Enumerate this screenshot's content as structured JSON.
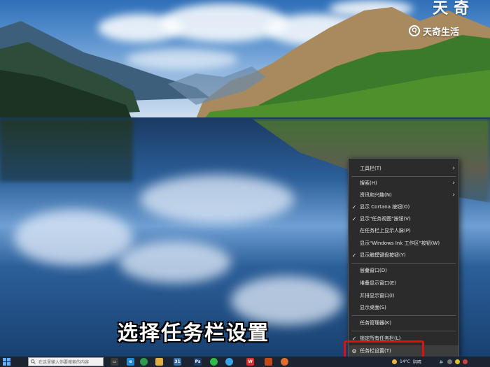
{
  "watermark": {
    "brand": "天奇生活",
    "logo_glyph": "Q",
    "corner_text": "天奇"
  },
  "subtitle": "选择任务栏设置",
  "context_menu": {
    "items": [
      {
        "label": "工具栏(T)",
        "has_submenu": true,
        "checked": false
      },
      {
        "label": "搜索(H)",
        "has_submenu": true,
        "checked": false
      },
      {
        "label": "资讯和兴趣(N)",
        "has_submenu": true,
        "checked": false
      },
      {
        "label": "显示 Cortana 按钮(O)",
        "has_submenu": false,
        "checked": true
      },
      {
        "label": "显示\"任务视图\"按钮(V)",
        "has_submenu": false,
        "checked": true
      },
      {
        "label": "在任务栏上显示人脉(P)",
        "has_submenu": false,
        "checked": false
      },
      {
        "label": "显示\"Windows Ink 工作区\"按钮(W)",
        "has_submenu": false,
        "checked": false
      },
      {
        "label": "显示触摸键盘按钮(Y)",
        "has_submenu": false,
        "checked": true
      },
      {
        "label": "层叠窗口(D)",
        "has_submenu": false,
        "checked": false
      },
      {
        "label": "堆叠显示窗口(E)",
        "has_submenu": false,
        "checked": false
      },
      {
        "label": "并排显示窗口(I)",
        "has_submenu": false,
        "checked": false
      },
      {
        "label": "显示桌面(S)",
        "has_submenu": false,
        "checked": false
      },
      {
        "label": "任务管理器(K)",
        "has_submenu": false,
        "checked": false
      },
      {
        "label": "锁定所有任务栏(L)",
        "has_submenu": false,
        "checked": true
      },
      {
        "label": "任务栏设置(T)",
        "has_submenu": false,
        "checked": false,
        "icon": "gear-icon",
        "highlighted": true
      }
    ]
  },
  "taskbar": {
    "search_placeholder": "在这里输入你要搜索的内容",
    "apps": [
      {
        "name": "edge-icon",
        "glyph": "e",
        "color": "#1e8ad6"
      },
      {
        "name": "chrome-icon",
        "glyph": "",
        "color": "#2e9a4e"
      },
      {
        "name": "folder-icon",
        "glyph": "",
        "color": "#e0b040"
      },
      {
        "name": "calendar-icon",
        "glyph": "31",
        "color": "#3a6ea5"
      },
      {
        "name": "photoshop-icon",
        "glyph": "Ps",
        "color": "#1c3c6b"
      },
      {
        "name": "wechat-icon",
        "glyph": "",
        "color": "#2dbb45"
      },
      {
        "name": "tencent-icon",
        "glyph": "",
        "color": "#3aa3e8"
      },
      {
        "name": "wps-icon",
        "glyph": "W",
        "color": "#d92f2f"
      },
      {
        "name": "docs-icon",
        "glyph": "",
        "color": "#c24a1a"
      },
      {
        "name": "browser-icon",
        "glyph": "",
        "color": "#e06d2e"
      }
    ],
    "tray": {
      "temperature": "14°C",
      "weather": "阴晴"
    }
  }
}
